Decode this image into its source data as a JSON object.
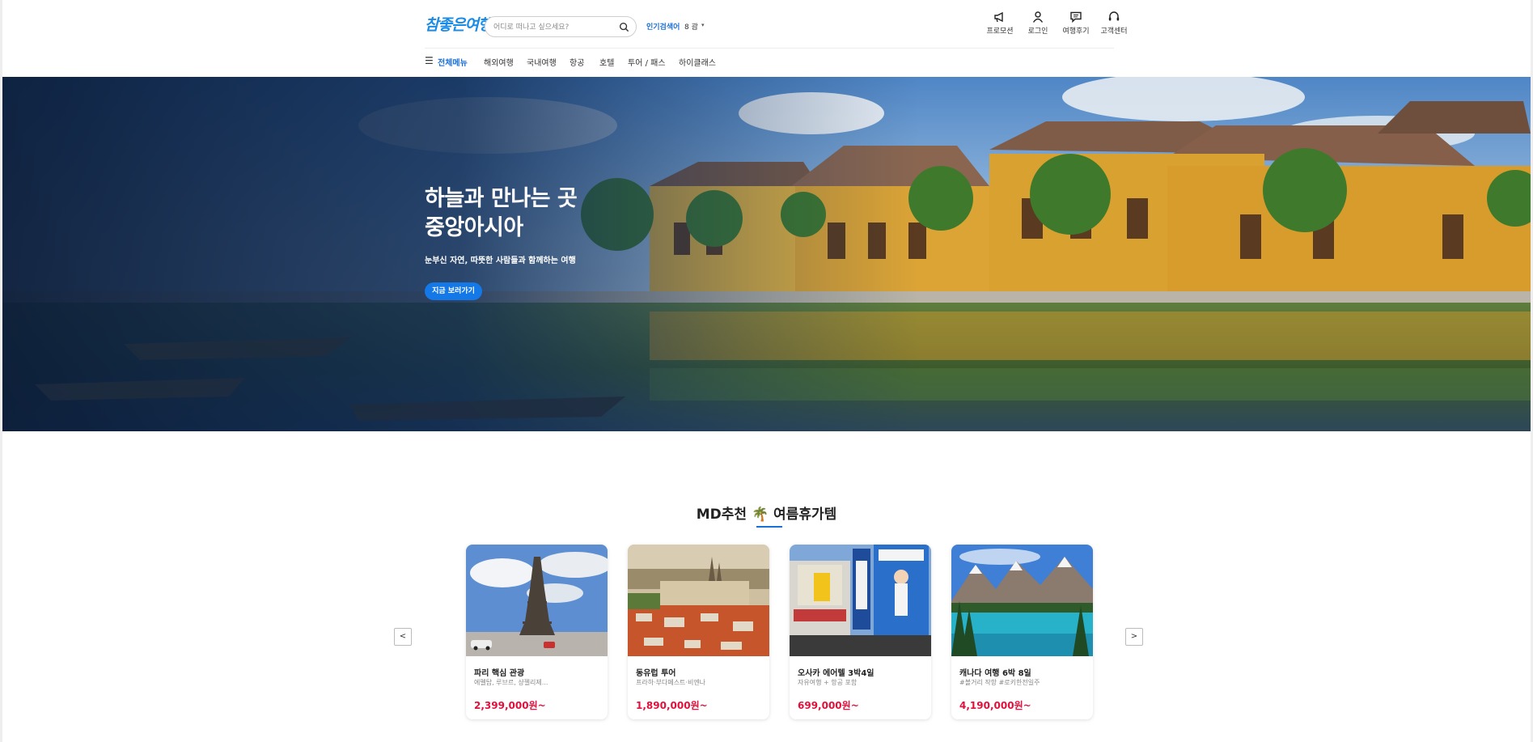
{
  "header": {
    "logo": "참좋은여행",
    "search_placeholder": "어디로 떠나고 싶으세요?",
    "popular_label": "인기검색어",
    "popular_value": "8 괌",
    "utilities": [
      {
        "label": "프로모션",
        "icon": "megaphone-icon"
      },
      {
        "label": "로그인",
        "icon": "user-icon"
      },
      {
        "label": "여행후기",
        "icon": "chat-icon"
      },
      {
        "label": "고객센터",
        "icon": "headset-icon"
      }
    ],
    "nav": {
      "all_menu": "전체메뉴",
      "items": [
        "해외여행",
        "국내여행",
        "항공",
        "호텔",
        "투어 / 패스",
        "하이클래스"
      ]
    }
  },
  "hero": {
    "title_line1": "하늘과 만나는 곳",
    "title_line2": "중앙아시아",
    "subtitle": "눈부신 자연, 따뜻한 사람들과 함께하는 여행",
    "button": "지금 보러가기"
  },
  "recommend": {
    "title": "MD추천 🌴 여름휴가템",
    "prev": "<",
    "next": ">",
    "cards": [
      {
        "name": "파리 핵심 관광",
        "desc": "에펠탑, 루브르, 샹젤리제...",
        "price": "2,399,000원~"
      },
      {
        "name": "동유럽 투어",
        "desc": "프라하·부다페스트·비엔나",
        "price": "1,890,000원~"
      },
      {
        "name": "오사카 에어텔 3박4일",
        "desc": "자유여행 + 항공 포함",
        "price": "699,000원~"
      },
      {
        "name": "캐나다 여행 6박 8일",
        "desc": "#볼거리 작항 #로키한전일주",
        "price": "4,190,000원~"
      }
    ]
  },
  "colors": {
    "brand": "#1a8ce8",
    "accent": "#1478e6",
    "price": "#e2103c"
  }
}
